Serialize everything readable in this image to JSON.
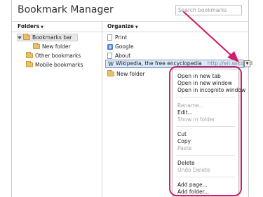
{
  "app": {
    "title": "Bookmark Manager",
    "search": {
      "placeholder": "Search bookmarks",
      "value": ""
    }
  },
  "columns": {
    "folders_label": "Folders",
    "organize_label": "Organize"
  },
  "tree": [
    {
      "label": "Bookmarks bar",
      "expanded": true,
      "selected": true,
      "icon": "folder-icon"
    },
    {
      "label": "New folder",
      "icon": "folder-icon"
    },
    {
      "label": "Other bookmarks",
      "icon": "folder-icon"
    },
    {
      "label": "Mobile bookmarks",
      "icon": "folder-icon"
    }
  ],
  "list": [
    {
      "title": "Print",
      "icon": "page-icon"
    },
    {
      "title": "Google",
      "icon": "google-icon"
    },
    {
      "title": "About",
      "icon": "page-icon"
    },
    {
      "title": "Wikipedia, the free encyclopedia",
      "url": "http://en.wikipedi",
      "icon": "wikipedia-icon",
      "selected": true
    },
    {
      "title": "New folder",
      "icon": "folder-icon"
    }
  ],
  "row_dropdown_glyph": "▼",
  "context_menu": {
    "items": [
      {
        "label": "Open in new tab",
        "disabled": false
      },
      {
        "label": "Open in new window",
        "disabled": false
      },
      {
        "label": "Open in incognito window",
        "disabled": false
      },
      {
        "label": "Rename...",
        "disabled": true
      },
      {
        "label": "Edit...",
        "disabled": false
      },
      {
        "label": "Show in folder",
        "disabled": true
      },
      {
        "label": "Cut",
        "disabled": false
      },
      {
        "label": "Copy",
        "disabled": false
      },
      {
        "label": "Paste",
        "disabled": true
      },
      {
        "label": "Delete",
        "disabled": false
      },
      {
        "label": "Undo Delete",
        "disabled": true
      },
      {
        "label": "Add page...",
        "disabled": false
      },
      {
        "label": "Add folder...",
        "disabled": false
      }
    ]
  },
  "colors": {
    "annotation": "#d21e6a",
    "selection_border": "#7da2ce",
    "selection_fill": "#dbe7f6"
  }
}
